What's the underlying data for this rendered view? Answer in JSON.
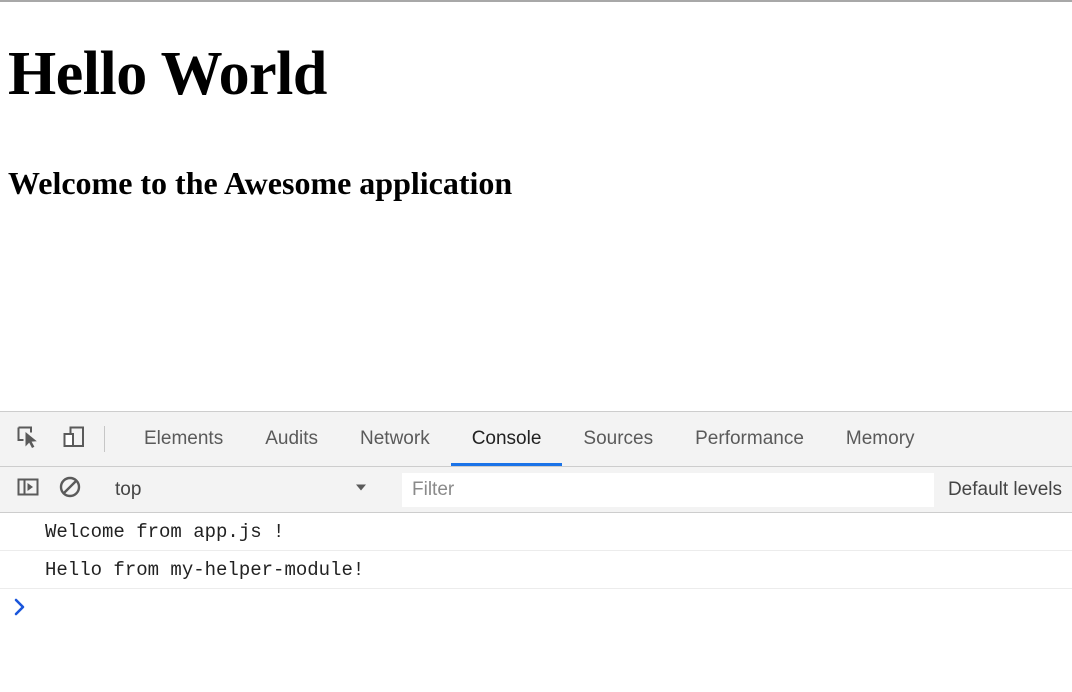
{
  "page": {
    "h1": "Hello World",
    "h2": "Welcome to the Awesome application"
  },
  "devtools": {
    "toolbar": {
      "inspect_icon": "inspect-element-icon",
      "device_icon": "device-toolbar-icon"
    },
    "tabs": [
      {
        "label": "Elements",
        "active": false
      },
      {
        "label": "Audits",
        "active": false
      },
      {
        "label": "Network",
        "active": false
      },
      {
        "label": "Console",
        "active": true
      },
      {
        "label": "Sources",
        "active": false
      },
      {
        "label": "Performance",
        "active": false
      },
      {
        "label": "Memory",
        "active": false
      }
    ],
    "active_tab": "Console",
    "accent_color": "#1a73e8",
    "console_toolbar": {
      "sidebar_icon": "console-sidebar-toggle-icon",
      "clear_icon": "clear-console-icon",
      "context": "top",
      "filter_placeholder": "Filter",
      "filter_value": "",
      "levels": "Default levels"
    },
    "console_messages": [
      {
        "text": "Welcome from app.js !"
      },
      {
        "text": "Hello from my-helper-module!"
      }
    ],
    "console_prompt": {
      "chevron": "prompt-chevron-icon",
      "value": ""
    }
  }
}
